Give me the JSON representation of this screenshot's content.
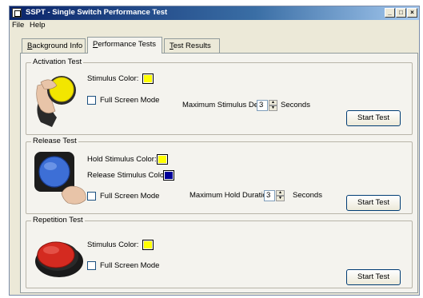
{
  "window": {
    "title": "SSPT - Single Switch Performance Test",
    "min_glyph": "_",
    "max_glyph": "□",
    "close_glyph": "×"
  },
  "menu": {
    "file": "File",
    "help": "Help"
  },
  "tabs": [
    {
      "label": "Background Info",
      "active": false
    },
    {
      "label": "Performance Tests",
      "active": true
    },
    {
      "label": "Test Results",
      "active": false
    }
  ],
  "activation": {
    "title": "Activation Test",
    "stimulus_color_label": "Stimulus Color:",
    "stimulus_color": "#ffff00",
    "full_screen_label": "Full Screen Mode",
    "full_screen_checked": false,
    "max_delay_label": "Maximum Stimulus Delay:",
    "max_delay_value": "3",
    "units": "Seconds",
    "start_label": "Start Test",
    "switch_color": "#f2e600"
  },
  "release": {
    "title": "Release Test",
    "hold_color_label": "Hold Stimulus Color:",
    "hold_color": "#ffff00",
    "release_color_label": "Release Stimulus Color:",
    "release_color": "#000099",
    "full_screen_label": "Full Screen Mode",
    "full_screen_checked": false,
    "max_hold_label": "Maximum Hold Duration:",
    "max_hold_value": "3",
    "units": "Seconds",
    "start_label": "Start Test",
    "switch_color": "#3d6fd6"
  },
  "repetition": {
    "title": "Repetition Test",
    "stimulus_color_label": "Stimulus Color:",
    "stimulus_color": "#ffff00",
    "full_screen_label": "Full Screen Mode",
    "full_screen_checked": false,
    "start_label": "Start Test",
    "switch_color": "#d42a20"
  }
}
